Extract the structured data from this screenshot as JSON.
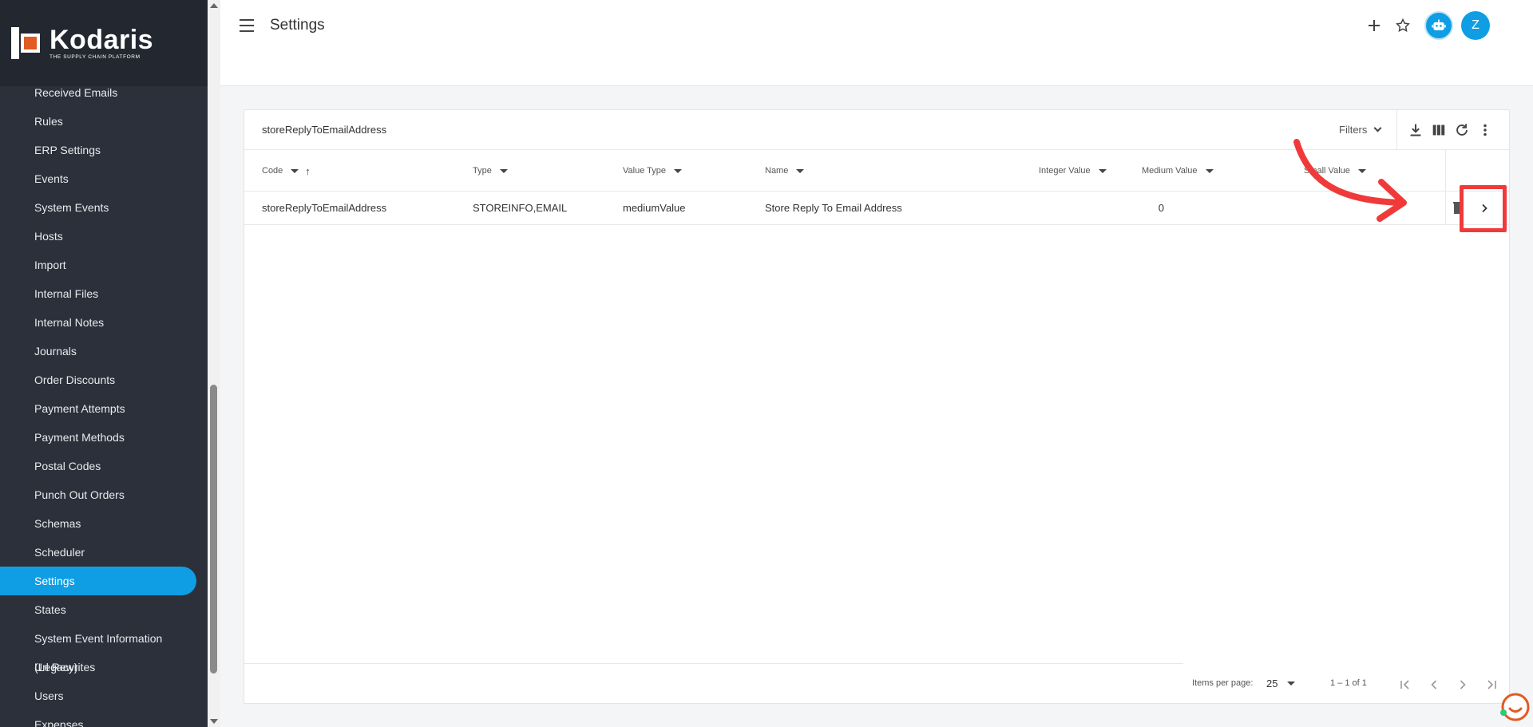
{
  "brand": {
    "name": "Kodaris",
    "tagline": "THE SUPPLY CHAIN PLATFORM"
  },
  "sidebar": {
    "items": [
      {
        "label": "Received Emails"
      },
      {
        "label": "Rules"
      },
      {
        "label": "ERP Settings"
      },
      {
        "label": "Events"
      },
      {
        "label": "System Events"
      },
      {
        "label": "Hosts"
      },
      {
        "label": "Import"
      },
      {
        "label": "Internal Files"
      },
      {
        "label": "Internal Notes"
      },
      {
        "label": "Journals"
      },
      {
        "label": "Order Discounts"
      },
      {
        "label": "Payment Attempts"
      },
      {
        "label": "Payment Methods"
      },
      {
        "label": "Postal Codes"
      },
      {
        "label": "Punch Out Orders"
      },
      {
        "label": "Schemas"
      },
      {
        "label": "Scheduler"
      },
      {
        "label": "Settings",
        "active": true
      },
      {
        "label": "States"
      },
      {
        "label": "System Event Information (Legacy)"
      },
      {
        "label": "Url Rewrites"
      },
      {
        "label": "Users"
      },
      {
        "label": "Expenses"
      }
    ]
  },
  "header": {
    "title": "Settings",
    "avatar_initial": "Z",
    "icons": [
      "add-icon",
      "star-icon",
      "help-icon",
      "bot-icon"
    ]
  },
  "table": {
    "search_value": "storeReplyToEmailAddress",
    "filters_label": "Filters",
    "columns": {
      "code": "Code",
      "type": "Type",
      "value_type": "Value Type",
      "name": "Name",
      "integer_value": "Integer Value",
      "medium_value": "Medium Value",
      "small_value": "Small Value"
    },
    "rows": [
      {
        "code": "storeReplyToEmailAddress",
        "type": "STOREINFO,EMAIL",
        "value_type": "mediumValue",
        "name": "Store Reply To Email Address",
        "integer_value": "0",
        "medium_value": "",
        "small_value": ""
      }
    ]
  },
  "paginator": {
    "items_per_page_label": "Items per page:",
    "items_per_page": "25",
    "range": "1 – 1 of 1"
  },
  "colors": {
    "accent": "#0f9ee4",
    "sidebar_bg": "#2b303a",
    "annotation": "#f03a3a",
    "logo_orange": "#e15b23"
  }
}
